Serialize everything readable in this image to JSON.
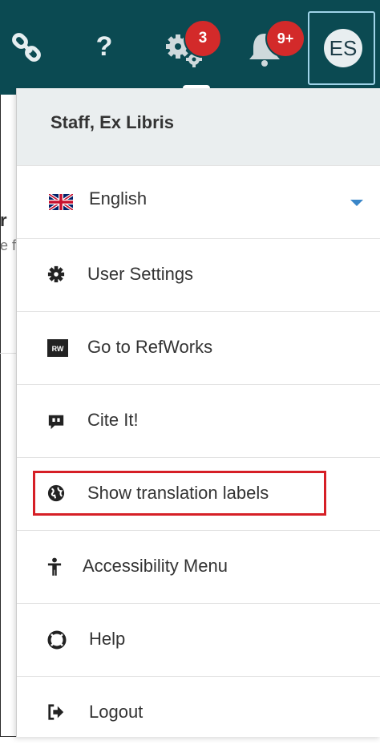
{
  "topbar": {
    "tasks_badge": "3",
    "notifications_badge": "9+",
    "help_glyph": "?",
    "avatar_initials": "ES",
    "icons": [
      "link-icon",
      "help-icon",
      "gears-icon",
      "bell-icon"
    ],
    "background_color": "#0b4a52",
    "badge_color": "#d32a2a"
  },
  "background_page": {
    "fragment1": "r",
    "fragment2": "e f"
  },
  "menu": {
    "user_name": "Staff, Ex Libris",
    "language": "English",
    "items": [
      {
        "label": "User Settings",
        "icon": "gear-icon"
      },
      {
        "label": "Go to RefWorks",
        "icon": "refworks-icon",
        "icon_text": "RW"
      },
      {
        "label": "Cite It!",
        "icon": "quote-icon"
      },
      {
        "label": "Show translation labels",
        "icon": "globe-icon",
        "highlighted": true
      },
      {
        "label": "Accessibility Menu",
        "icon": "accessibility-icon"
      },
      {
        "label": "Help",
        "icon": "lifebuoy-icon"
      },
      {
        "label": "Logout",
        "icon": "logout-icon"
      }
    ],
    "highlight_color": "#d61f26",
    "dropdown_arrow_color": "#3a86c8"
  }
}
